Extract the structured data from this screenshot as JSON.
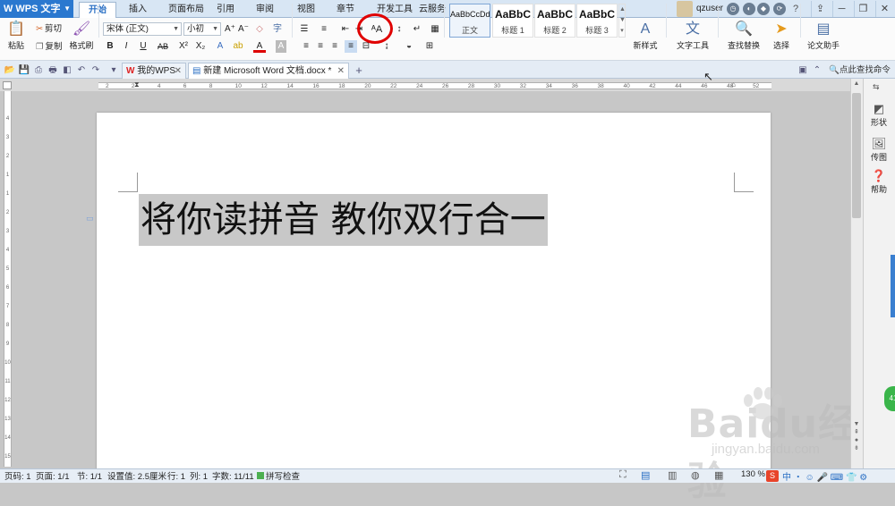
{
  "app": {
    "name": "WPS 文字",
    "logo": "W"
  },
  "menu": {
    "tabs": [
      "开始",
      "插入",
      "页面布局",
      "引用",
      "审阅",
      "视图",
      "章节",
      "开发工具",
      "云服务"
    ],
    "active_tab": "开始"
  },
  "user": {
    "name": "qzuser"
  },
  "window": {
    "minimize": "─",
    "restore": "❐",
    "close": "✕",
    "help": "?"
  },
  "ribbon": {
    "paste": "粘贴",
    "cut": "剪切",
    "copy": "复制",
    "format_painter": "格式刷",
    "font_name": "宋体 (正文)",
    "font_size": "小初",
    "styles": [
      {
        "preview": "AaBbCcDd",
        "label": "正文"
      },
      {
        "preview": "AaBbC",
        "label": "标题 1"
      },
      {
        "preview": "AaBbC",
        "label": "标题 2"
      },
      {
        "preview": "AaBbC",
        "label": "标题 3"
      }
    ],
    "new_style": "新样式",
    "text_tools": "文字工具",
    "find_replace": "查找替换",
    "select": "选择",
    "thesis_helper": "论文助手"
  },
  "tabs_bar": {
    "tabs": [
      {
        "label": "我的WPS"
      },
      {
        "label": "新建 Microsoft Word 文档.docx *"
      }
    ],
    "search_hint": "点此查找命令"
  },
  "ruler": {
    "h_ticks": [
      "2",
      "2",
      "4",
      "6",
      "8",
      "10",
      "12",
      "14",
      "16",
      "18",
      "20",
      "22",
      "24",
      "26",
      "28",
      "30",
      "32",
      "34",
      "36",
      "38",
      "40",
      "42",
      "44",
      "46",
      "48",
      "52"
    ],
    "v_ticks": [
      "4",
      "3",
      "2",
      "1",
      "1",
      "2",
      "3",
      "4",
      "5",
      "6",
      "7",
      "8",
      "9",
      "10",
      "11",
      "12",
      "13",
      "14",
      "15",
      "16"
    ]
  },
  "document": {
    "text": "将你读拼音 教你双行合一"
  },
  "side_panel": {
    "shape": "形状",
    "image": "传图",
    "help": "帮助"
  },
  "status": {
    "page_no": "页码: 1",
    "pages": "页面: 1/1",
    "section": "节: 1/1",
    "setting": "设置值: 2.5厘米",
    "row": "行: 1",
    "col": "列: 1",
    "words": "字数: 11/11",
    "spell": "拼写检查",
    "zoom": "130 %"
  },
  "watermark": {
    "brand": "Baidu经验",
    "url": "jingyan.baidu.com"
  },
  "badge": "41"
}
